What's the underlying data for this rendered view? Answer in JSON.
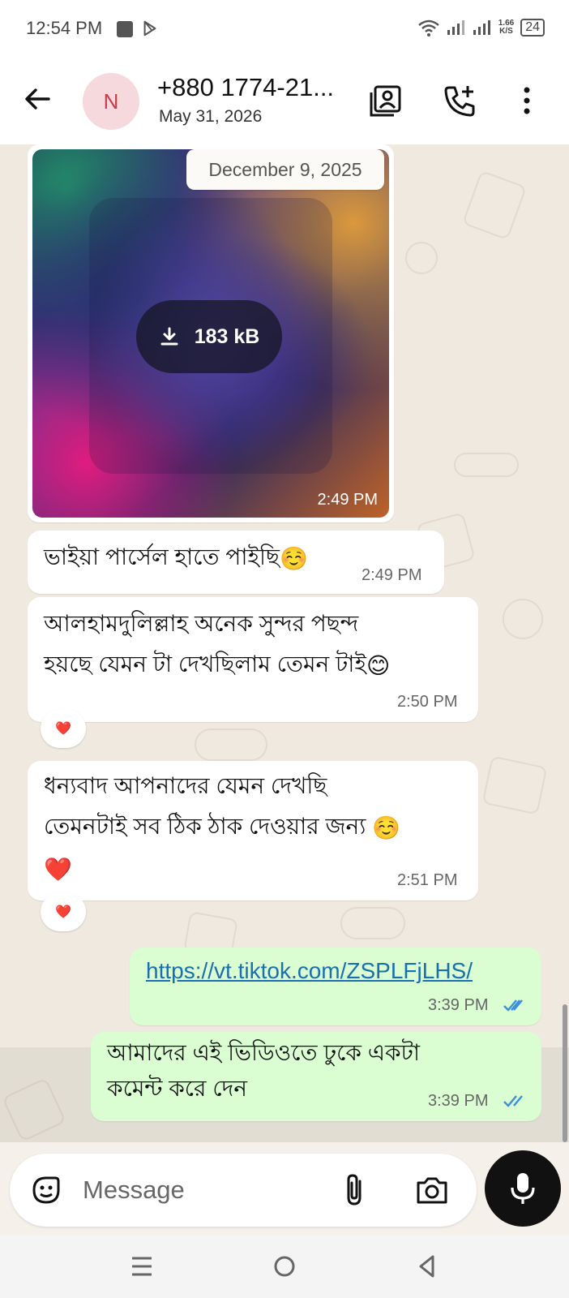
{
  "status_bar": {
    "time": "12:54 PM",
    "speed_value": "1.66",
    "speed_unit": "K/S",
    "battery": "24"
  },
  "header": {
    "avatar_initial": "N",
    "contact_name": "+880 1774-21...",
    "subtitle": "May 31, 2026",
    "icons": [
      "back-arrow-icon",
      "contact-card-icon",
      "add-call-icon",
      "more-vertical-icon"
    ]
  },
  "chat": {
    "date_chip": "December 9, 2025",
    "image_message": {
      "download_size": "183 kB",
      "time": "2:49 PM"
    },
    "messages": [
      {
        "direction": "in",
        "lines": [
          "ভাইয়া পার্সেল হাতে পাইছি"
        ],
        "emoji": "☺️",
        "time": "2:49 PM",
        "reaction": ""
      },
      {
        "direction": "in",
        "lines": [
          "আলহামদুলিল্লাহ অনেক সুন্দর পছন্দ",
          "হয়ছে যেমন টা দেখছিলাম তেমন টাই"
        ],
        "emoji": "😊",
        "time": "2:50 PM",
        "reaction": "❤️"
      },
      {
        "direction": "in",
        "lines": [
          "ধন্যবাদ আপনাদের যেমন দেখছি",
          "তেমনটাই সব ঠিক ঠাক দেওয়ার জন্য"
        ],
        "emoji": "☺️",
        "extra_emoji": "❤️",
        "time": "2:51 PM",
        "reaction": "❤️"
      },
      {
        "direction": "out",
        "link": "https://vt.tiktok.com/ZSPLFjLHS/",
        "time": "3:39 PM",
        "status": "read"
      },
      {
        "direction": "out",
        "lines": [
          "আমাদের এই ভিডিওতে ঢুকে একটা",
          "কমেন্ট করে দেন"
        ],
        "time": "3:39 PM",
        "status": "read"
      }
    ]
  },
  "composer": {
    "placeholder": "Message",
    "icons": [
      "sticker-icon",
      "attach-icon",
      "camera-icon",
      "mic-icon"
    ]
  },
  "nav_bar": {
    "icons": [
      "menu-icon",
      "home-icon",
      "back-icon"
    ]
  },
  "colors": {
    "outgoing_bubble": "#dafdd2",
    "incoming_bubble": "#ffffff",
    "chat_background": "#efe9df",
    "read_ticks": "#3b8ee0",
    "mic_button": "#111111"
  }
}
